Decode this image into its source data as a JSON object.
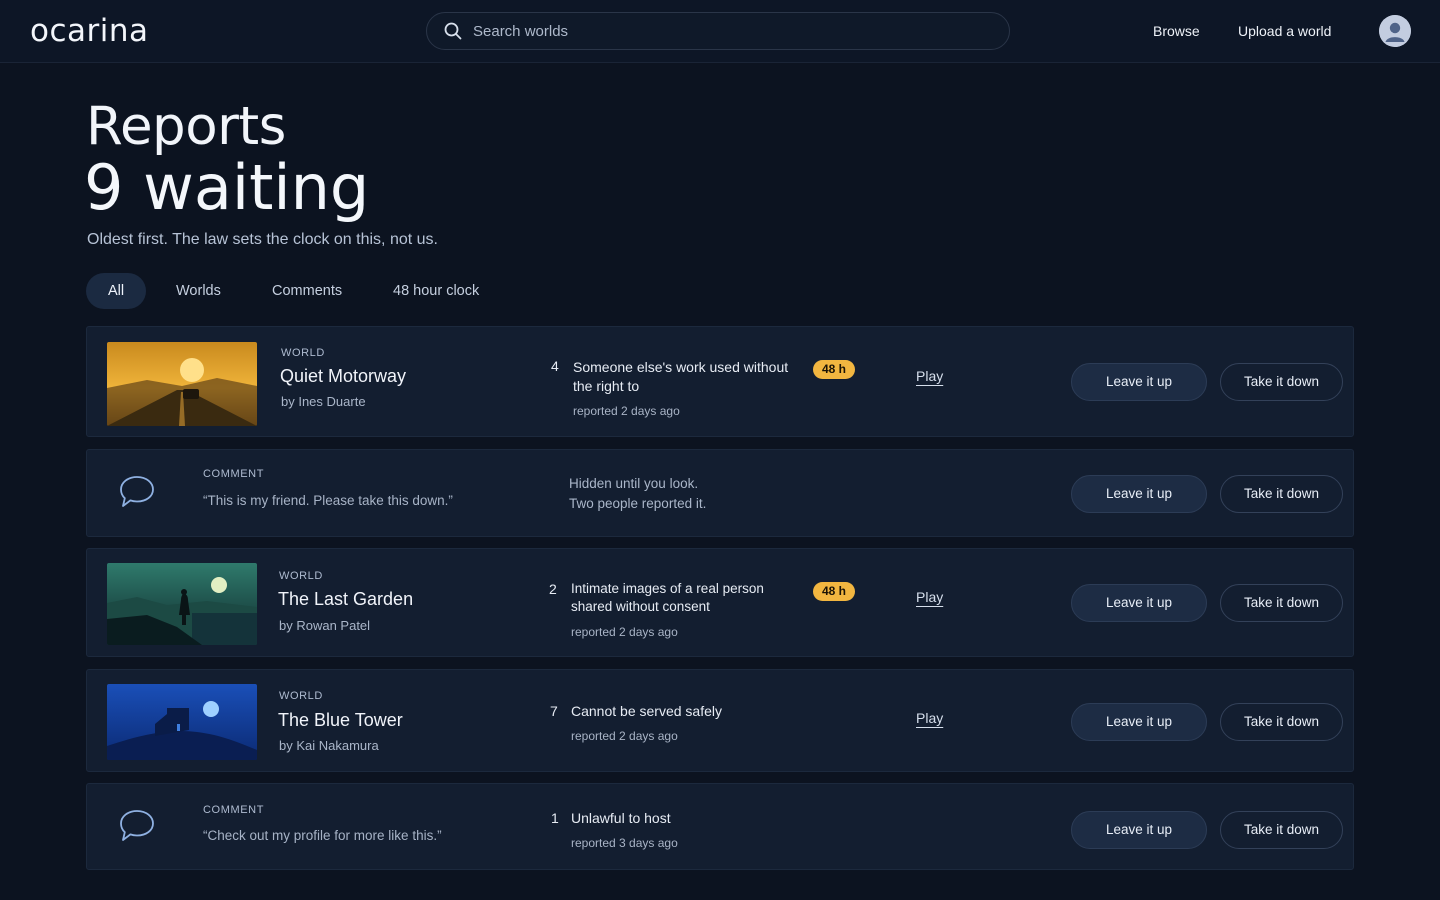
{
  "app": {
    "logo": "ocarina"
  },
  "header": {
    "search_placeholder": "Search worlds",
    "nav": {
      "browse": "Browse",
      "upload": "Upload a world"
    },
    "icons": {
      "search": "search-icon",
      "avatar": "user-avatar-icon"
    }
  },
  "page": {
    "title": "Reports",
    "count": "9 waiting",
    "subtitle": "Oldest first. The law sets the clock on this, not us."
  },
  "tabs": [
    "All",
    "Worlds",
    "Comments",
    "48 hour clock"
  ],
  "active_tab": "All",
  "reports": [
    {
      "kind": "WORLD",
      "title": "Quiet Motorway",
      "author": "by Ines Duarte",
      "count": "4",
      "reason": "Someone else's work used without the right to",
      "when": "reported 2 days ago",
      "badge": "48 h",
      "play": "Play",
      "leave": "Leave it up",
      "take": "Take it down"
    },
    {
      "kind": "COMMENT",
      "quote": "“This is my friend. Please take this down.”",
      "note_line1": "Hidden until you look.",
      "note_line2": "Two people reported it.",
      "leave": "Leave it up",
      "take": "Take it down",
      "icon": "speech-bubble-icon"
    },
    {
      "kind": "WORLD",
      "title": "The Last Garden",
      "author": "by Rowan Patel",
      "count": "2",
      "reason": "Intimate images of a real person shared without consent",
      "when": "reported 2 days ago",
      "badge": "48 h",
      "play": "Play",
      "leave": "Leave it up",
      "take": "Take it down"
    },
    {
      "kind": "WORLD",
      "title": "The Blue Tower",
      "author": "by Kai Nakamura",
      "count": "7",
      "reason": "Cannot be served safely",
      "when": "reported 2 days ago",
      "play": "Play",
      "leave": "Leave it up",
      "take": "Take it down"
    },
    {
      "kind": "COMMENT",
      "quote": "“Check out my profile for more like this.”",
      "count": "1",
      "reason": "Unlawful to host",
      "when": "reported 3 days ago",
      "leave": "Leave it up",
      "take": "Take it down",
      "icon": "speech-bubble-icon"
    }
  ],
  "colors": {
    "background": "#0c1320",
    "card": "#131e30",
    "badge": "#f2b640",
    "accent_tab": "#1b2a41"
  }
}
